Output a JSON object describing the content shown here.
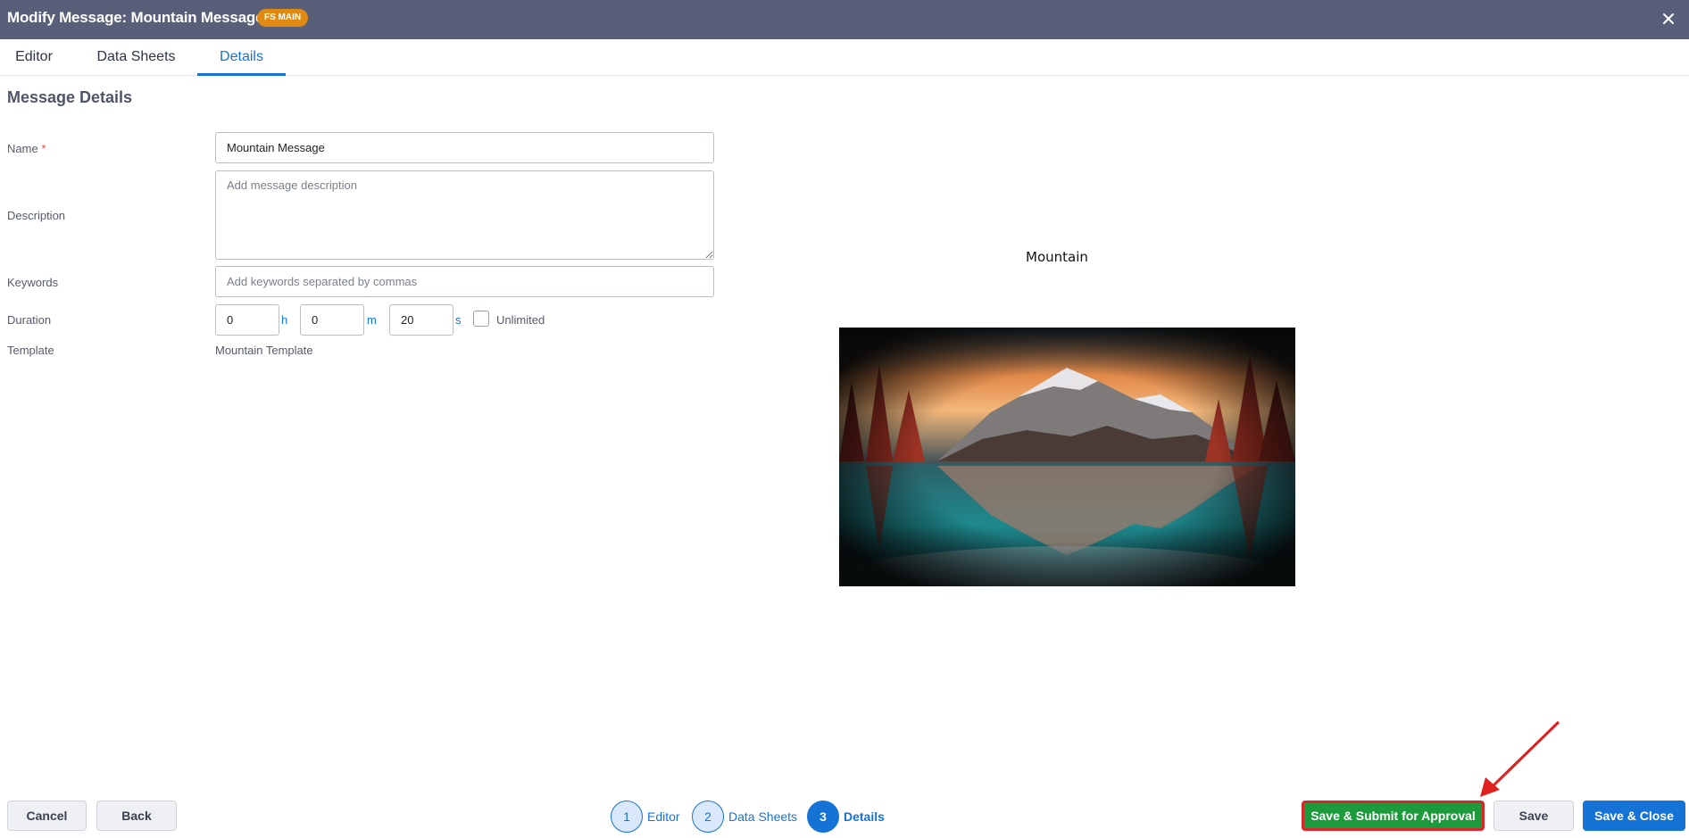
{
  "header": {
    "title": "Modify Message: Mountain Message",
    "badge": "FS MAIN",
    "close_icon": "close-icon"
  },
  "tabs": [
    {
      "label": "Editor"
    },
    {
      "label": "Data Sheets"
    },
    {
      "label": "Details",
      "active": true
    }
  ],
  "details": {
    "section_title": "Message Details",
    "name_label": "Name",
    "name_required": "*",
    "name_value": "Mountain Message",
    "description_label": "Description",
    "description_placeholder": "Add message description",
    "keywords_label": "Keywords",
    "keywords_placeholder": "Add keywords separated by commas",
    "duration_label": "Duration",
    "duration": {
      "hours": "0",
      "h_unit": "h",
      "minutes": "0",
      "m_unit": "m",
      "seconds": "20",
      "s_unit": "s"
    },
    "unlimited_label": "Unlimited",
    "unlimited_checked": false,
    "template_label": "Template",
    "template_value": "Mountain Template"
  },
  "preview": {
    "title": "Mountain"
  },
  "footer": {
    "cancel": "Cancel",
    "back": "Back",
    "steps": [
      {
        "number": "1",
        "label": "Editor"
      },
      {
        "number": "2",
        "label": "Data Sheets"
      },
      {
        "number": "3",
        "label": "Details",
        "active": true
      }
    ],
    "submit": "Save & Submit for Approval",
    "save": "Save",
    "save_close": "Save & Close"
  },
  "colors": {
    "header_bg": "#5a5f79",
    "badge_bg": "#e08a12",
    "accent": "#1673d6",
    "submit_bg": "#1c9a3c",
    "highlight_border": "#d9262b"
  }
}
